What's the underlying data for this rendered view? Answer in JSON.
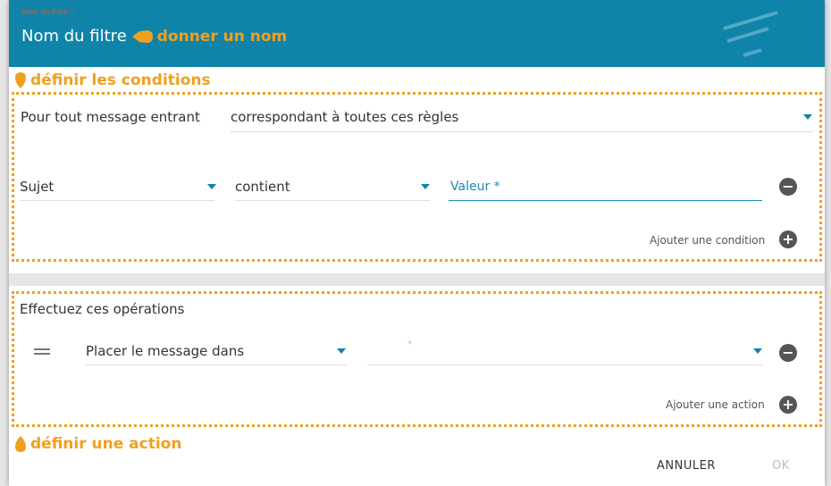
{
  "header": {
    "tiny_label": "Nom du filtre *",
    "title": "Nom du filtre"
  },
  "annotations": {
    "name": "donner un nom",
    "conditions": "définir les conditions",
    "action": "définir une action",
    "color": "#f0a020"
  },
  "conditions": {
    "incoming_label": "Pour tout message entrant",
    "match_select": "correspondant à toutes ces règles",
    "rule": {
      "field": "Sujet",
      "operator": "contient",
      "value_placeholder": "Valeur *"
    },
    "add_label": "Ajouter une condition"
  },
  "actions": {
    "heading": "Effectuez ces opérations",
    "action_select": "Placer le message dans",
    "target_placeholder": "*",
    "add_label": "Ajouter une action"
  },
  "footer": {
    "cancel": "ANNULER",
    "ok": "OK"
  },
  "colors": {
    "header_bg": "#0f84a8",
    "accent": "#0f84a8"
  }
}
